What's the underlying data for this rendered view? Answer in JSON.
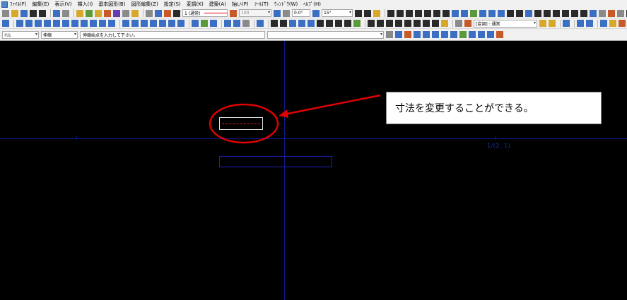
{
  "menubar": {
    "items": [
      "ﾌｧｲﾙ(F)",
      "編集(E)",
      "表示(V)",
      "挿入(I)",
      "基本図形(B)",
      "図形編集(Z)",
      "設定(S)",
      "変調(K)",
      "建築(A)",
      "抽い(P)",
      "ﾂｰﾙ(T)",
      "ｳｨﾝﾄﾞｳ(W)",
      "ﾍﾙﾌﾟ(H)"
    ]
  },
  "toolbar1": {
    "line_type_value": "1 (通常)",
    "weight_value": "100",
    "angle_value": "0.0°",
    "snap_angle_value": "15°"
  },
  "toolbar2": {
    "layer_value": "[変調] : 通常"
  },
  "toolbar3": {
    "mode_value": "ﾄﾘﾑ",
    "submode_value": "伸縮",
    "prompt_text": "伸縮始点を入力して下さい。"
  },
  "canvas": {
    "coord_label": "1/(2, 1)"
  },
  "annotation": {
    "text": "寸法を変更することができる。",
    "color": "#e00000"
  },
  "colors": {
    "canvas_bg": "#000000",
    "axis": "#0a1a8a",
    "blue_shape": "#2020c0",
    "white_shape": "#e0e0e0"
  }
}
